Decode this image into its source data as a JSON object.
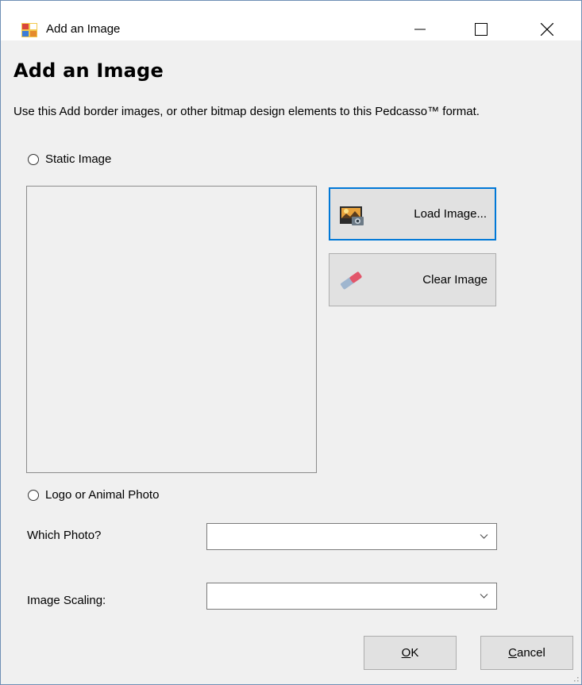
{
  "window": {
    "title": "Add an Image"
  },
  "dialog": {
    "heading": "Add an Image",
    "description": "Use this Add border images, or other bitmap design elements to this Pedcasso™ format.",
    "static_image_label": "Static Image",
    "logo_label": "Logo or Animal Photo",
    "load_label": "Load Image...",
    "clear_label": "Clear Image",
    "which_photo_label": "Which Photo?",
    "which_photo_value": "",
    "scaling_label": "Image Scaling:",
    "scaling_value": "",
    "ok_mnemonic": "O",
    "ok_rest": "K",
    "cancel_mnemonic": "C",
    "cancel_rest": "ancel"
  },
  "colors": {
    "focus_border": "#0078d7",
    "button_face": "#e1e1e1",
    "window_bg": "#f0f0f0"
  },
  "icons": {
    "app": "app-icon",
    "minimize": "minimize-icon",
    "maximize": "maximize-icon",
    "close": "close-icon",
    "load": "photo-camera-icon",
    "clear": "eraser-icon"
  }
}
